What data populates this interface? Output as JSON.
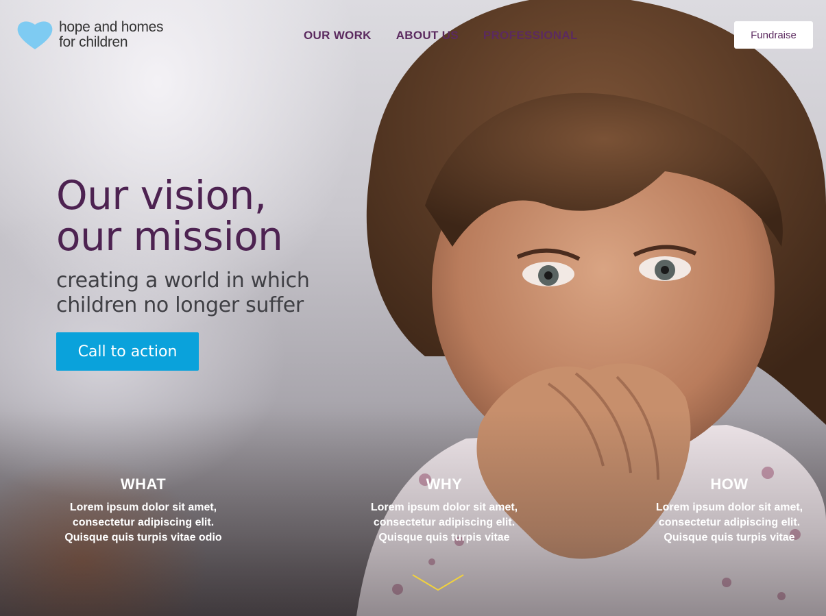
{
  "brand": {
    "logo_line1": "hope and homes",
    "logo_line2": "for children",
    "heart_color": "#7ecbf2"
  },
  "nav": {
    "items": [
      {
        "label": "OUR WORK"
      },
      {
        "label": "ABOUT US"
      },
      {
        "label": "PROFESSIONAL"
      }
    ],
    "fundraise_label": "Fundraise"
  },
  "hero": {
    "title_line1": "Our vision,",
    "title_line2": "our mission",
    "subtitle_line1": "creating a world in which",
    "subtitle_line2": "children no longer suffer",
    "cta_label": "Call to action",
    "title_color": "#4d2251",
    "cta_color": "#0aa2db"
  },
  "columns": [
    {
      "heading": "WHAT",
      "line1": "Lorem ipsum dolor sit amet,",
      "line2": "consectetur adipiscing elit.",
      "line3": "Quisque quis turpis vitae odio"
    },
    {
      "heading": "WHY",
      "line1": "Lorem ipsum dolor sit amet,",
      "line2": "consectetur adipiscing elit.",
      "line3": "Quisque quis turpis vitae"
    },
    {
      "heading": "HOW",
      "line1": "Lorem ipsum dolor sit amet,",
      "line2": "consectetur adipiscing elit.",
      "line3": "Quisque quis turpis vitae"
    }
  ],
  "icons": {
    "logo": "heart-icon",
    "scroll": "chevron-down-icon"
  }
}
